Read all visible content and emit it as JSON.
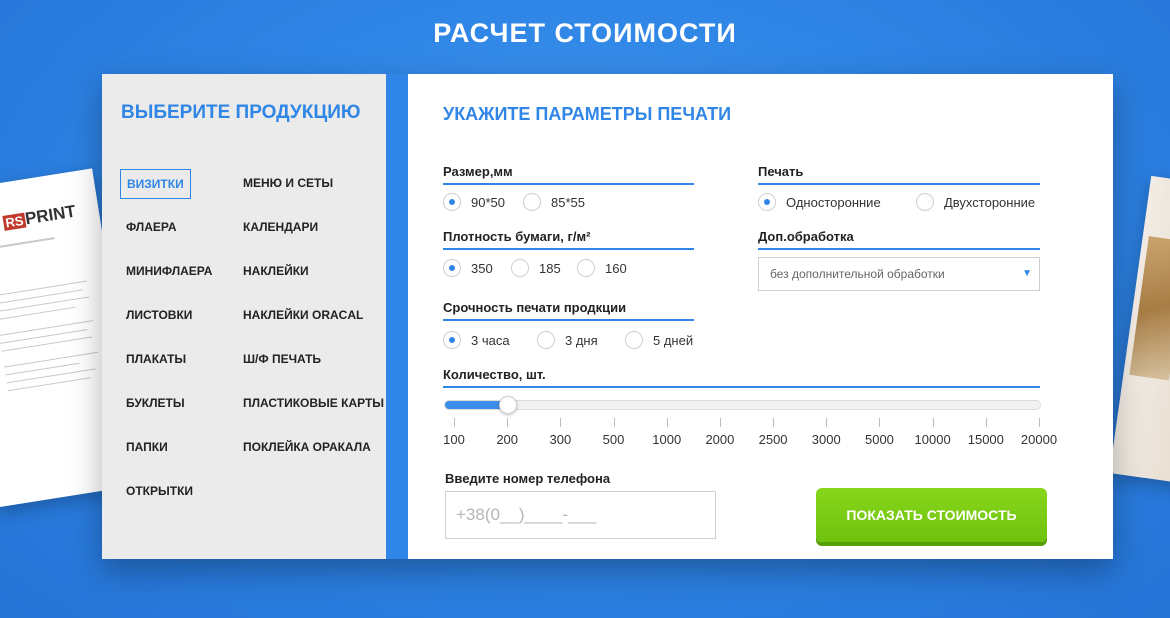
{
  "page": {
    "title": "РАСЧЕТ СТОИМОСТИ"
  },
  "decor": {
    "logo_text": "PRINT",
    "logo_mark": "RS"
  },
  "sidebar": {
    "title": "ВЫБЕРИТЕ ПРОДУКЦИЮ",
    "products": [
      {
        "label": "ВИЗИТКИ",
        "active": true
      },
      {
        "label": "МЕНЮ И СЕТЫ",
        "active": false
      },
      {
        "label": "ФЛАЕРА",
        "active": false
      },
      {
        "label": "КАЛЕНДАРИ",
        "active": false
      },
      {
        "label": "МИНИФЛАЕРА",
        "active": false
      },
      {
        "label": "НАКЛЕЙКИ",
        "active": false
      },
      {
        "label": "ЛИСТОВКИ",
        "active": false
      },
      {
        "label": "НАКЛЕЙКИ ORACAL",
        "active": false
      },
      {
        "label": "ПЛАКАТЫ",
        "active": false
      },
      {
        "label": "Ш/Ф ПЕЧАТЬ",
        "active": false
      },
      {
        "label": "БУКЛЕТЫ",
        "active": false
      },
      {
        "label": "ПЛАСТИКОВЫЕ КАРТЫ",
        "active": false
      },
      {
        "label": "ПАПКИ",
        "active": false
      },
      {
        "label": "ПОКЛЕЙКА ОРАКАЛА",
        "active": false
      },
      {
        "label": "ОТКРЫТКИ",
        "active": false
      }
    ]
  },
  "main": {
    "title": "УКАЖИТЕ ПАРАМЕТРЫ ПЕЧАТИ",
    "size": {
      "label": "Размер,мм",
      "options": [
        {
          "label": "90*50",
          "checked": true
        },
        {
          "label": "85*55",
          "checked": false
        }
      ]
    },
    "print": {
      "label": "Печать",
      "options": [
        {
          "label": "Односторонние",
          "checked": true
        },
        {
          "label": "Двухсторонние",
          "checked": false
        }
      ]
    },
    "density": {
      "label": "Плотность бумаги, г/м²",
      "options": [
        {
          "label": "350",
          "checked": true
        },
        {
          "label": "185",
          "checked": false
        },
        {
          "label": "160",
          "checked": false
        }
      ]
    },
    "processing": {
      "label": "Доп.обработка",
      "selected": "без дополнительной обработки"
    },
    "urgency": {
      "label": "Срочность печати продкции",
      "options": [
        {
          "label": "3 часа",
          "checked": true
        },
        {
          "label": "3 дня",
          "checked": false
        },
        {
          "label": "5 дней",
          "checked": false
        }
      ]
    },
    "quantity": {
      "label": "Количество, шт.",
      "ticks": [
        "100",
        "200",
        "300",
        "500",
        "1000",
        "2000",
        "2500",
        "3000",
        "5000",
        "10000",
        "15000",
        "20000"
      ],
      "selected": "200"
    },
    "phone": {
      "label": "Введите номер телефона",
      "placeholder": "+38(0__)____-___"
    },
    "submit_label": "ПОКАЗАТЬ СТОИМОСТЬ"
  },
  "colors": {
    "accent": "#2f86e6",
    "button": "#77cc12"
  }
}
